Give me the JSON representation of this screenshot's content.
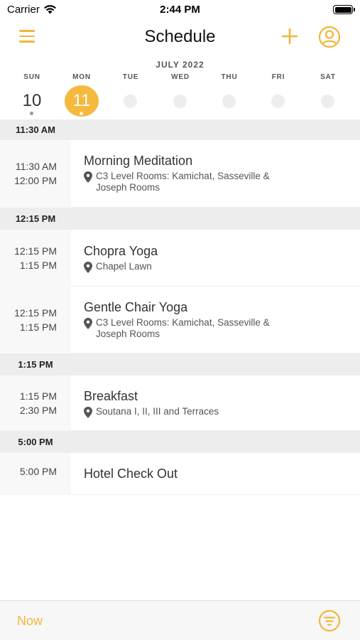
{
  "status_bar": {
    "carrier": "Carrier",
    "time": "2:44 PM"
  },
  "nav": {
    "title": "Schedule",
    "menu_icon": "hamburger-menu-icon",
    "add_icon": "plus-icon",
    "profile_icon": "user-circle-icon"
  },
  "calendar": {
    "month": "JULY 2022",
    "days": [
      {
        "name": "SUN",
        "number": "10",
        "has_events": true,
        "selected": false
      },
      {
        "name": "MON",
        "number": "11",
        "has_events": true,
        "selected": true
      },
      {
        "name": "TUE",
        "number": "",
        "has_events": false,
        "selected": false
      },
      {
        "name": "WED",
        "number": "",
        "has_events": false,
        "selected": false
      },
      {
        "name": "THU",
        "number": "",
        "has_events": false,
        "selected": false
      },
      {
        "name": "FRI",
        "number": "",
        "has_events": false,
        "selected": false
      },
      {
        "name": "SAT",
        "number": "",
        "has_events": false,
        "selected": false
      }
    ]
  },
  "sections": [
    {
      "header": "11:30 AM",
      "events": [
        {
          "start": "11:30 AM",
          "end": "12:00 PM",
          "title": "Morning Meditation",
          "location": "C3 Level Rooms: Kamichat, Sasseville & Joseph Rooms"
        }
      ]
    },
    {
      "header": "12:15 PM",
      "events": [
        {
          "start": "12:15 PM",
          "end": "1:15 PM",
          "title": "Chopra Yoga",
          "location": "Chapel Lawn"
        },
        {
          "start": "12:15 PM",
          "end": "1:15 PM",
          "title": "Gentle Chair Yoga",
          "location": "C3 Level Rooms: Kamichat, Sasseville & Joseph Rooms"
        }
      ]
    },
    {
      "header": "1:15 PM",
      "events": [
        {
          "start": "1:15 PM",
          "end": "2:30 PM",
          "title": "Breakfast",
          "location": "Soutana I, II, III and Terraces"
        }
      ]
    },
    {
      "header": "5:00 PM",
      "events": [
        {
          "start": "5:00 PM",
          "end": "",
          "title": "Hotel Check Out",
          "location": ""
        }
      ]
    }
  ],
  "toolbar": {
    "now_label": "Now",
    "filter_icon": "filter-icon"
  },
  "colors": {
    "accent": "#f5b93e",
    "section_bg": "#ededed",
    "time_bg": "#f8f8f8"
  }
}
